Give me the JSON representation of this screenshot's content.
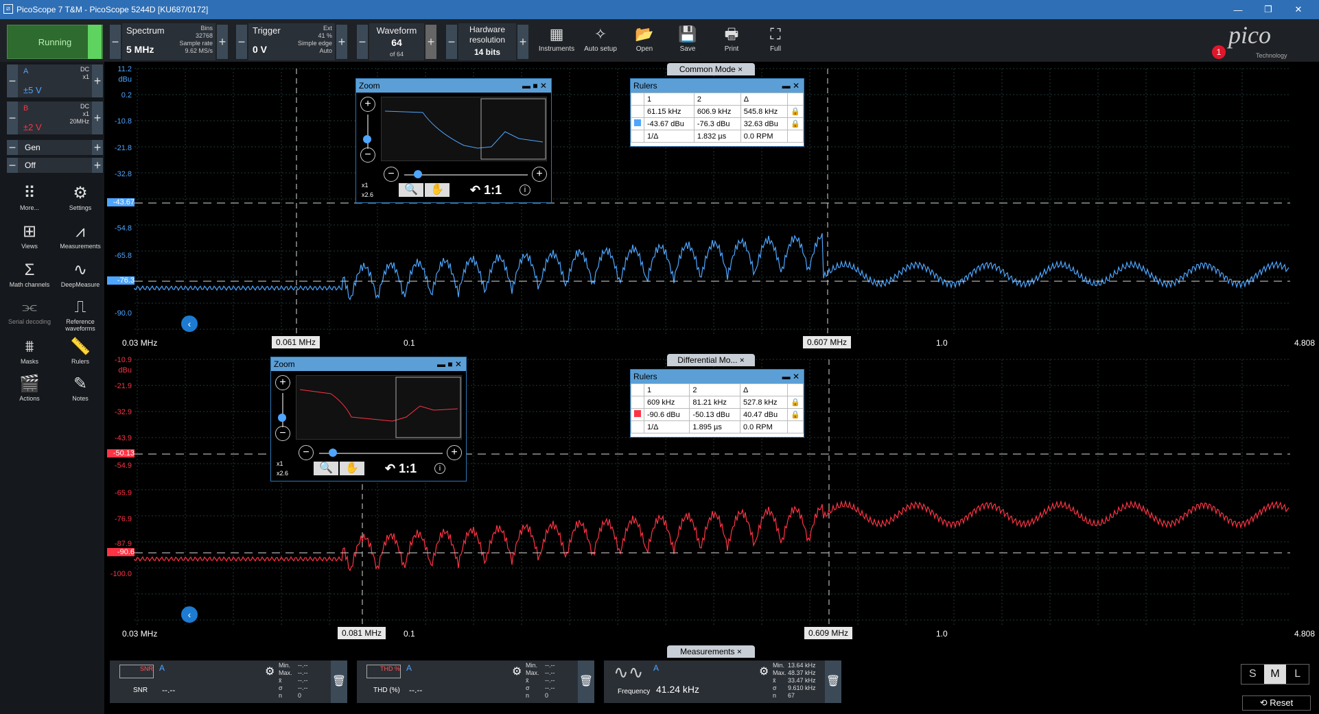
{
  "window": {
    "title": "PicoScope 7 T&M - PicoScope 5244D [KU687/0172]"
  },
  "toolbar": {
    "run_label": "Running",
    "spectrum": {
      "label": "Spectrum",
      "value": "5 MHz",
      "bins_label": "Bins",
      "bins": "32768",
      "rate_label": "Sample rate",
      "rate": "9.62 MS/s"
    },
    "trigger": {
      "label": "Trigger",
      "value": "0 V",
      "ext": "Ext",
      "pct": "41 %",
      "mode": "Simple edge",
      "auto": "Auto"
    },
    "waveform": {
      "label": "Waveform",
      "value": "64",
      "of": "of 64"
    },
    "hwres": {
      "label1": "Hardware",
      "label2": "resolution",
      "value": "14 bits"
    },
    "buttons": [
      "Instruments",
      "Auto setup",
      "Open",
      "Save",
      "Print",
      "Full"
    ],
    "notif": "1"
  },
  "logo": {
    "word": "pico",
    "sub": "Technology"
  },
  "channels": [
    {
      "name": "A",
      "coupling": "DC",
      "probe": "x1",
      "range": "±5 V",
      "color": "#4ea6ff"
    },
    {
      "name": "B",
      "coupling": "DC",
      "probe": "x1",
      "bw": "20MHz",
      "range": "±2 V",
      "color": "#ff3344"
    },
    {
      "name": "Gen"
    },
    {
      "name": "Off"
    }
  ],
  "sidebar": [
    "More...",
    "Settings",
    "Views",
    "Measurements",
    "Math channels",
    "DeepMeasure",
    "Serial decoding",
    "Reference waveforms",
    "Masks",
    "Rulers",
    "Actions",
    "Notes"
  ],
  "top_view": {
    "tab": "Common Mode",
    "unit": "dBu",
    "yticks": [
      "11.2",
      "0.2",
      "-10.8",
      "-21.8",
      "-32.8",
      "-43.67",
      "-54.8",
      "-65.8",
      "-76.3",
      "-90.0"
    ],
    "xstart": "0.03 MHz",
    "x01": "0.1",
    "x10": "1.0",
    "xend": "4.808",
    "ruler1": "0.061 MHz",
    "ruler2": "0.607 MHz",
    "rulers": {
      "title": "Rulers",
      "hdr": [
        "1",
        "2",
        "Δ"
      ],
      "f": [
        "61.15 kHz",
        "606.9 kHz",
        "545.8 kHz"
      ],
      "a": [
        "-43.67 dBu",
        "-76.3 dBu",
        "32.63 dBu"
      ],
      "inv": [
        "1/Δ",
        "1.832 µs",
        "0.0 RPM"
      ]
    }
  },
  "bottom_view": {
    "tab": "Differential Mo...",
    "unit": "dBu",
    "yticks": [
      "-10.9",
      "-21.9",
      "-32.9",
      "-43.9",
      "-50.13",
      "-54.9",
      "-65.9",
      "-76.9",
      "-87.9",
      "-90.6",
      "-100.0"
    ],
    "xstart": "0.03 MHz",
    "x01": "0.1",
    "x10": "1.0",
    "xend": "4.808",
    "ruler1": "0.081 MHz",
    "ruler2": "0.609 MHz",
    "rulers": {
      "title": "Rulers",
      "hdr": [
        "1",
        "2",
        "Δ"
      ],
      "f": [
        "609 kHz",
        "81.21 kHz",
        "527.8 kHz"
      ],
      "a": [
        "-90.6 dBu",
        "-50.13 dBu",
        "40.47 dBu"
      ],
      "inv": [
        "1/Δ",
        "1.895 µs",
        "0.0 RPM"
      ]
    }
  },
  "zoom": {
    "title": "Zoom",
    "x1": "x1",
    "x26": "x2.6",
    "ratio": "1:1"
  },
  "measurements": {
    "tab": "Measurements",
    "cards": [
      {
        "name": "SNR",
        "ch": "A",
        "value": "--.--",
        "min": "--.--",
        "max": "--.--",
        "mean": "--.--",
        "sd": "--.--",
        "n": "0"
      },
      {
        "name": "THD (%)",
        "ch": "A",
        "value": "--.--",
        "min": "--.--",
        "max": "--.--",
        "mean": "--.--",
        "sd": "--.--",
        "n": "0"
      },
      {
        "name": "Frequency",
        "ch": "A",
        "value": "41.24 kHz",
        "min": "13.64 kHz",
        "max": "48.37 kHz",
        "mean": "33.47 kHz",
        "sd": "9.610 kHz",
        "n": "67"
      }
    ],
    "stat_labels": [
      "Min.",
      "Max.",
      "x̄",
      "σ",
      "n"
    ]
  },
  "size": {
    "s": "S",
    "m": "M",
    "l": "L",
    "reset": "Reset"
  }
}
